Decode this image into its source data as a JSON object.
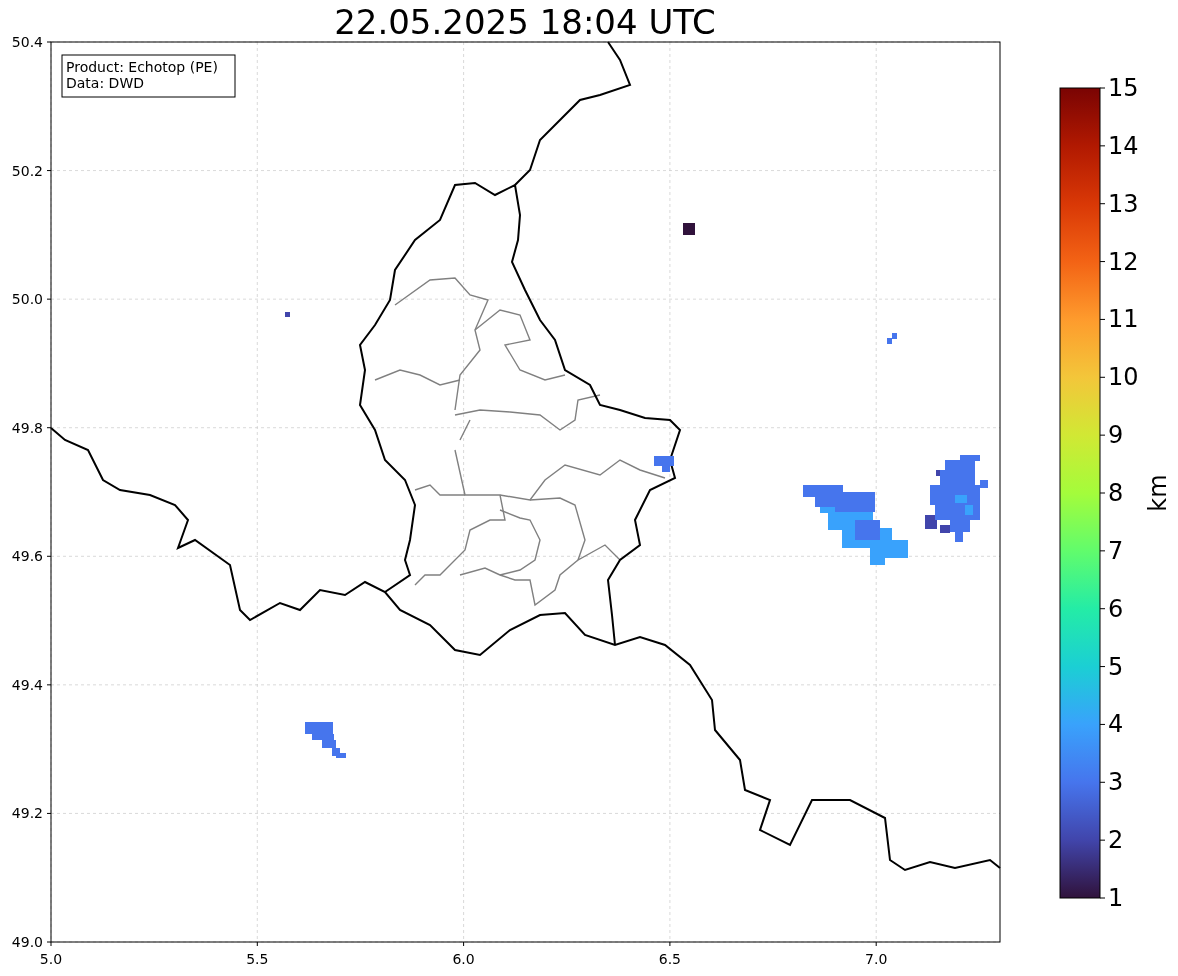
{
  "title": "22.05.2025 18:04 UTC",
  "info": [
    "Product: Echotop (PE)",
    "Data: DWD"
  ],
  "x_ticks": [
    "5.0",
    "5.5",
    "6.0",
    "6.5",
    "7.0"
  ],
  "y_ticks": [
    "50.4",
    "50.2",
    "50.0",
    "49.8",
    "49.6",
    "49.4",
    "49.2",
    "49.0"
  ],
  "colorbar": {
    "label": "km",
    "ticks": [
      "15",
      "14",
      "13",
      "12",
      "11",
      "10",
      "9",
      "8",
      "7",
      "6",
      "5",
      "4",
      "3",
      "2",
      "1"
    ]
  }
}
